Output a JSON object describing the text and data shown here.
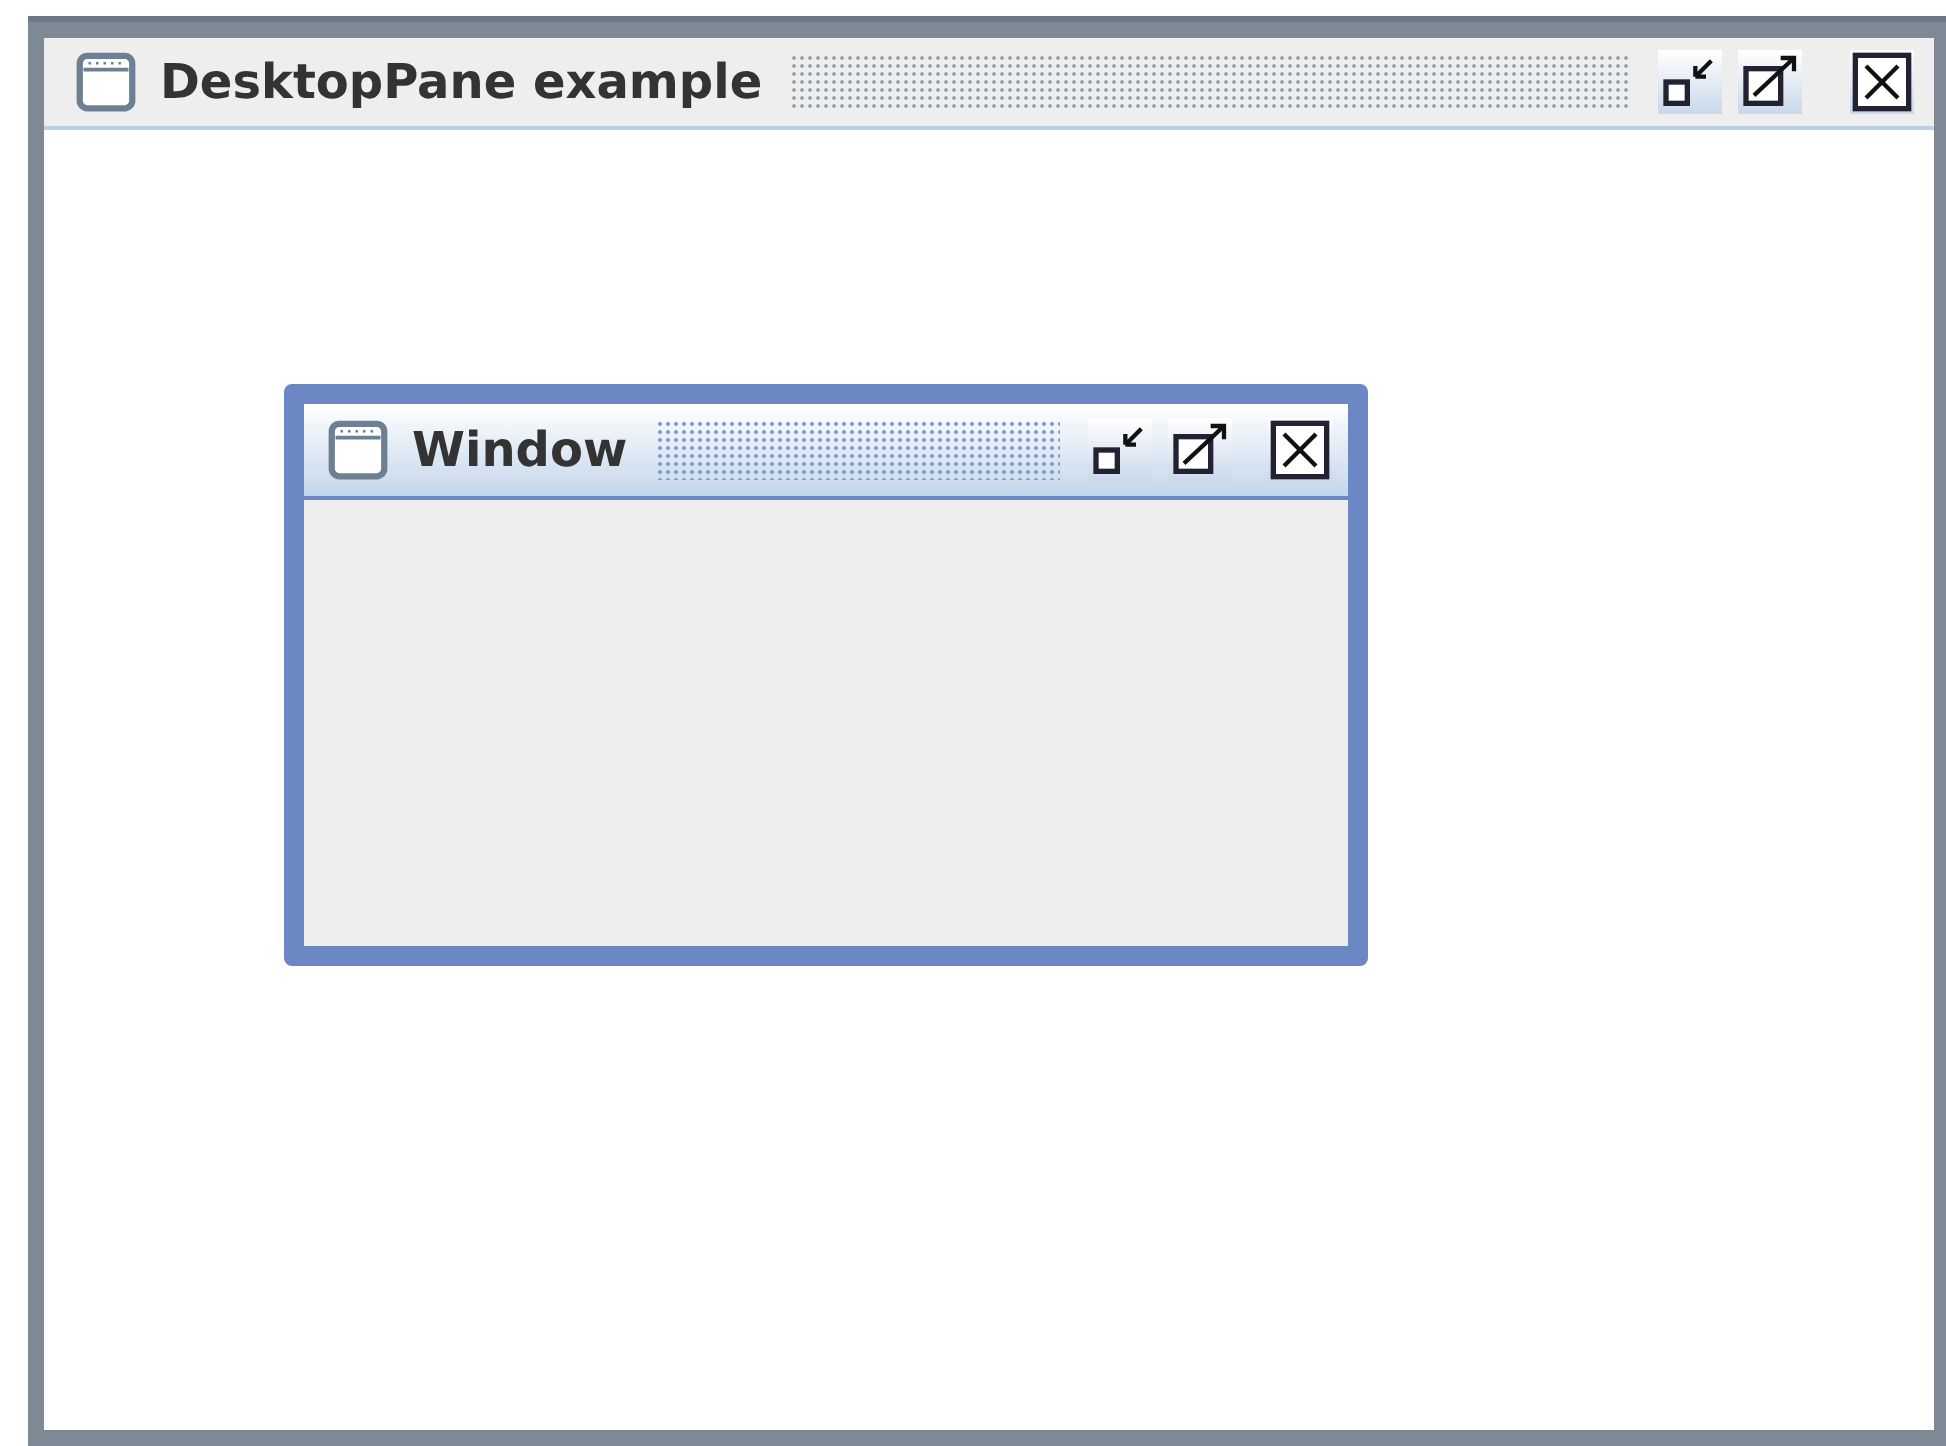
{
  "window": {
    "title": "DesktopPane example",
    "active": false
  },
  "internal_frames": [
    {
      "title": "Window",
      "active": true
    }
  ]
}
